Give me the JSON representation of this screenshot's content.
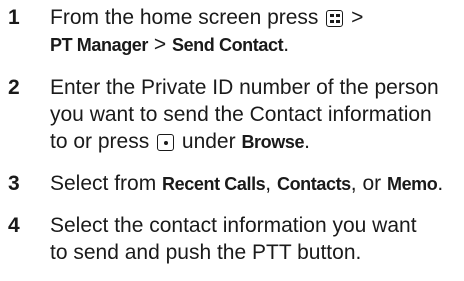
{
  "steps": [
    {
      "number": "1",
      "line1_text": "From the home screen press",
      "line1_sep": ">",
      "line2_bold1": "PT Manager",
      "line2_sep": " > ",
      "line2_bold2": "Send Contact",
      "line2_end": ".",
      "icon": "menu-key-icon"
    },
    {
      "number": "2",
      "line1": "Enter the Private ID number of the person",
      "line2": "you want to send the Contact information",
      "line3_pre": "to or press",
      "line3_mid": " under ",
      "line3_bold": "Browse",
      "line3_end": ".",
      "icon": "center-select-key-icon"
    },
    {
      "number": "3",
      "pre": "Select from ",
      "bold1": "Recent Calls",
      "sep1": ", ",
      "bold2": "Contacts",
      "sep2": ", or ",
      "bold3": "Memo",
      "end": "."
    },
    {
      "number": "4",
      "line1": "Select the contact information you want",
      "line2": "to send and push the PTT button."
    }
  ]
}
